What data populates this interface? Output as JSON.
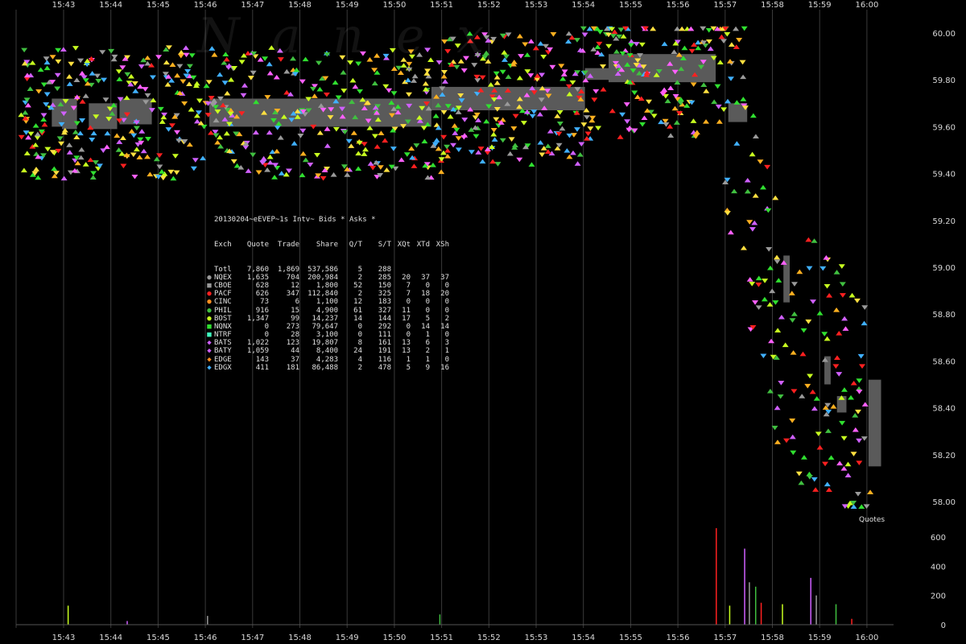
{
  "chart_data": {
    "type": "scatter",
    "legend_title": "20130204~eEVEP~1s Intv~ Bids * Asks *",
    "legend_header": [
      "Exch",
      "Quote",
      "Trade",
      "Share",
      "Q/T",
      "S/T",
      "XQt",
      "XTd",
      "XSh"
    ],
    "legend_rows": [
      {
        "exch": "Totl",
        "quote": "7,860",
        "trade": "1,869",
        "share": "537,586",
        "qt": "5",
        "st": "288",
        "xqt": "",
        "xtd": "",
        "xsh": "",
        "color": "",
        "symbol": ""
      },
      {
        "exch": "NQEX",
        "quote": "1,635",
        "trade": "704",
        "share": "200,984",
        "qt": "2",
        "st": "285",
        "xqt": "20",
        "xtd": "37",
        "xsh": "37",
        "color": "#9a9a9a",
        "symbol": "●"
      },
      {
        "exch": "CBOE",
        "quote": "628",
        "trade": "12",
        "share": "1,800",
        "qt": "52",
        "st": "150",
        "xqt": "7",
        "xtd": "0",
        "xsh": "0",
        "color": "#9a9a9a",
        "symbol": "■"
      },
      {
        "exch": "PACF",
        "quote": "626",
        "trade": "347",
        "share": "112,840",
        "qt": "2",
        "st": "325",
        "xqt": "7",
        "xtd": "18",
        "xsh": "20",
        "color": "#ff2020",
        "symbol": "●"
      },
      {
        "exch": "CINC",
        "quote": "73",
        "trade": "6",
        "share": "1,100",
        "qt": "12",
        "st": "183",
        "xqt": "0",
        "xtd": "0",
        "xsh": "0",
        "color": "#ff9020",
        "symbol": "●"
      },
      {
        "exch": "PHIL",
        "quote": "916",
        "trade": "15",
        "share": "4,900",
        "qt": "61",
        "st": "327",
        "xqt": "11",
        "xtd": "0",
        "xsh": "0",
        "color": "#40c040",
        "symbol": "●"
      },
      {
        "exch": "BOST",
        "quote": "1,347",
        "trade": "99",
        "share": "14,237",
        "qt": "14",
        "st": "144",
        "xqt": "17",
        "xtd": "5",
        "xsh": "2",
        "color": "#c8ff20",
        "symbol": "●"
      },
      {
        "exch": "NQNX",
        "quote": "0",
        "trade": "273",
        "share": "79,647",
        "qt": "0",
        "st": "292",
        "xqt": "0",
        "xtd": "14",
        "xsh": "14",
        "color": "#30e030",
        "symbol": "■"
      },
      {
        "exch": "NTRF",
        "quote": "0",
        "trade": "28",
        "share": "3,100",
        "qt": "0",
        "st": "111",
        "xqt": "0",
        "xtd": "1",
        "xsh": "0",
        "color": "#40ffc0",
        "symbol": "■"
      },
      {
        "exch": "BATS",
        "quote": "1,022",
        "trade": "123",
        "share": "19,807",
        "qt": "8",
        "st": "161",
        "xqt": "13",
        "xtd": "6",
        "xsh": "3",
        "color": "#d060ff",
        "symbol": "◆"
      },
      {
        "exch": "BATY",
        "quote": "1,059",
        "trade": "44",
        "share": "8,400",
        "qt": "24",
        "st": "191",
        "xqt": "13",
        "xtd": "2",
        "xsh": "1",
        "color": "#d060ff",
        "symbol": "◆"
      },
      {
        "exch": "EDGE",
        "quote": "143",
        "trade": "37",
        "share": "4,283",
        "qt": "4",
        "st": "116",
        "xqt": "1",
        "xtd": "1",
        "xsh": "0",
        "color": "#ff9020",
        "symbol": "◆"
      },
      {
        "exch": "EDGX",
        "quote": "411",
        "trade": "181",
        "share": "86,488",
        "qt": "2",
        "st": "478",
        "xqt": "5",
        "xtd": "9",
        "xsh": "16",
        "color": "#40b0ff",
        "symbol": "◆"
      }
    ],
    "time_ticks": [
      "15:43",
      "15:44",
      "15:45",
      "15:46",
      "15:47",
      "15:48",
      "15:49",
      "15:50",
      "15:51",
      "15:52",
      "15:53",
      "15:54",
      "15:55",
      "15:56",
      "15:57",
      "15:58",
      "15:59",
      "16:00"
    ],
    "price_ticks": [
      "60.00",
      "59.80",
      "59.60",
      "59.40",
      "59.20",
      "59.00",
      "58.80",
      "58.60",
      "58.40",
      "58.20",
      "58.00"
    ],
    "volume_ticks": [
      "600",
      "400",
      "200",
      "0"
    ],
    "price_range": [
      57.94,
      60.05
    ],
    "volume_range": [
      0,
      700
    ],
    "quotes_label": "Quotes",
    "watermark": "Nanex",
    "nbbo_spread": [
      {
        "t0": "15:42:45",
        "t1": "15:42:58",
        "lo": 59.6,
        "hi": 59.72
      },
      {
        "t0": "15:42:58",
        "t1": "15:43:17",
        "lo": 59.59,
        "hi": 59.72
      },
      {
        "t0": "15:43:32",
        "t1": "15:44:08",
        "lo": 59.59,
        "hi": 59.7
      },
      {
        "t0": "15:44:11",
        "t1": "15:44:52",
        "lo": 59.61,
        "hi": 59.72
      },
      {
        "t0": "15:46:05",
        "t1": "15:50:47",
        "lo": 59.6,
        "hi": 59.72
      },
      {
        "t0": "15:50:47",
        "t1": "15:54:02",
        "lo": 59.67,
        "hi": 59.77
      },
      {
        "t0": "15:54:02",
        "t1": "15:54:32",
        "lo": 59.8,
        "hi": 59.85
      },
      {
        "t0": "15:54:32",
        "t1": "15:56:48",
        "lo": 59.79,
        "hi": 59.91
      },
      {
        "t0": "15:57:04",
        "t1": "15:57:28",
        "lo": 59.62,
        "hi": 59.7
      },
      {
        "t0": "15:58:14",
        "t1": "15:58:22",
        "lo": 58.85,
        "hi": 59.05
      },
      {
        "t0": "15:59:06",
        "t1": "15:59:14",
        "lo": 58.5,
        "hi": 58.62
      },
      {
        "t0": "15:59:22",
        "t1": "15:59:34",
        "lo": 58.38,
        "hi": 58.45
      },
      {
        "t0": "16:00:02",
        "t1": "16:00:18",
        "lo": 58.15,
        "hi": 58.52
      }
    ],
    "volume_bars": [
      {
        "t": "15:43:05",
        "v": 130
      },
      {
        "t": "15:44:20",
        "v": 25
      },
      {
        "t": "15:46:02",
        "v": 60
      },
      {
        "t": "15:50:57",
        "v": 70
      },
      {
        "t": "15:56:48",
        "v": 660
      },
      {
        "t": "15:57:05",
        "v": 130
      },
      {
        "t": "15:57:24",
        "v": 520
      },
      {
        "t": "15:57:30",
        "v": 290
      },
      {
        "t": "15:57:38",
        "v": 260
      },
      {
        "t": "15:57:45",
        "v": 150
      },
      {
        "t": "15:58:12",
        "v": 140
      },
      {
        "t": "15:58:48",
        "v": 320
      },
      {
        "t": "15:58:55",
        "v": 200
      },
      {
        "t": "15:59:20",
        "v": 140
      },
      {
        "t": "15:59:40",
        "v": 40
      }
    ]
  }
}
